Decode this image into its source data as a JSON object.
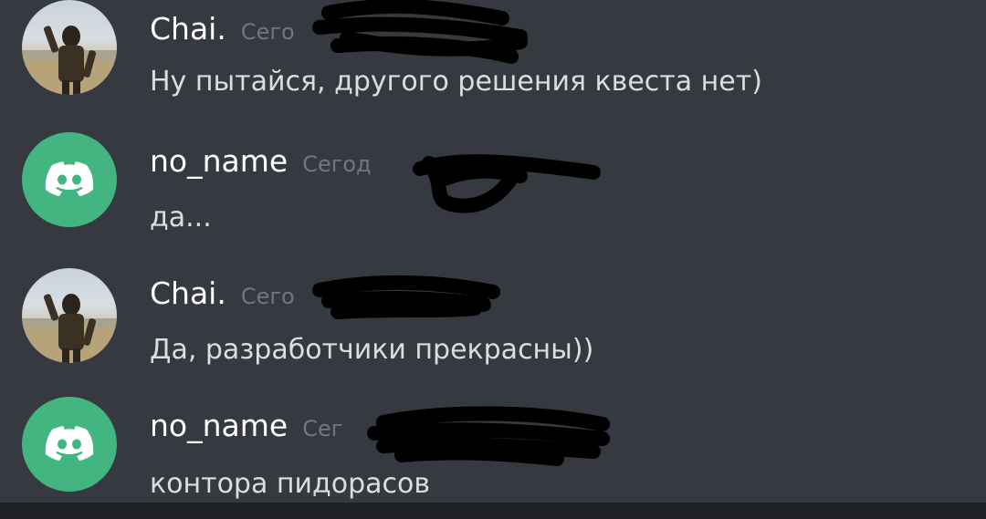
{
  "messages": [
    {
      "author": "Chai.",
      "avatar_kind": "photo",
      "avatar_icon": "user-photo-avatar",
      "timestamp_visible": "Сего",
      "text": "Ну пытайся, другого решения квеста нет)"
    },
    {
      "author": "no_name",
      "avatar_kind": "discord",
      "avatar_icon": "discord-logo-icon",
      "timestamp_visible": "Сегод",
      "text": "да..."
    },
    {
      "author": "Chai.",
      "avatar_kind": "photo",
      "avatar_icon": "user-photo-avatar",
      "timestamp_visible": "Сего",
      "text": "Да, разработчики прекрасны))"
    },
    {
      "author": "no_name",
      "avatar_kind": "discord",
      "avatar_icon": "discord-logo-icon",
      "timestamp_visible": "Сег",
      "text": "контора пидорасов"
    }
  ],
  "colors": {
    "background": "#36393f",
    "discord_green": "#43b581",
    "username": "#ffffff",
    "message_text": "#dcddde",
    "timestamp": "#72767d",
    "redaction": "#000000"
  }
}
